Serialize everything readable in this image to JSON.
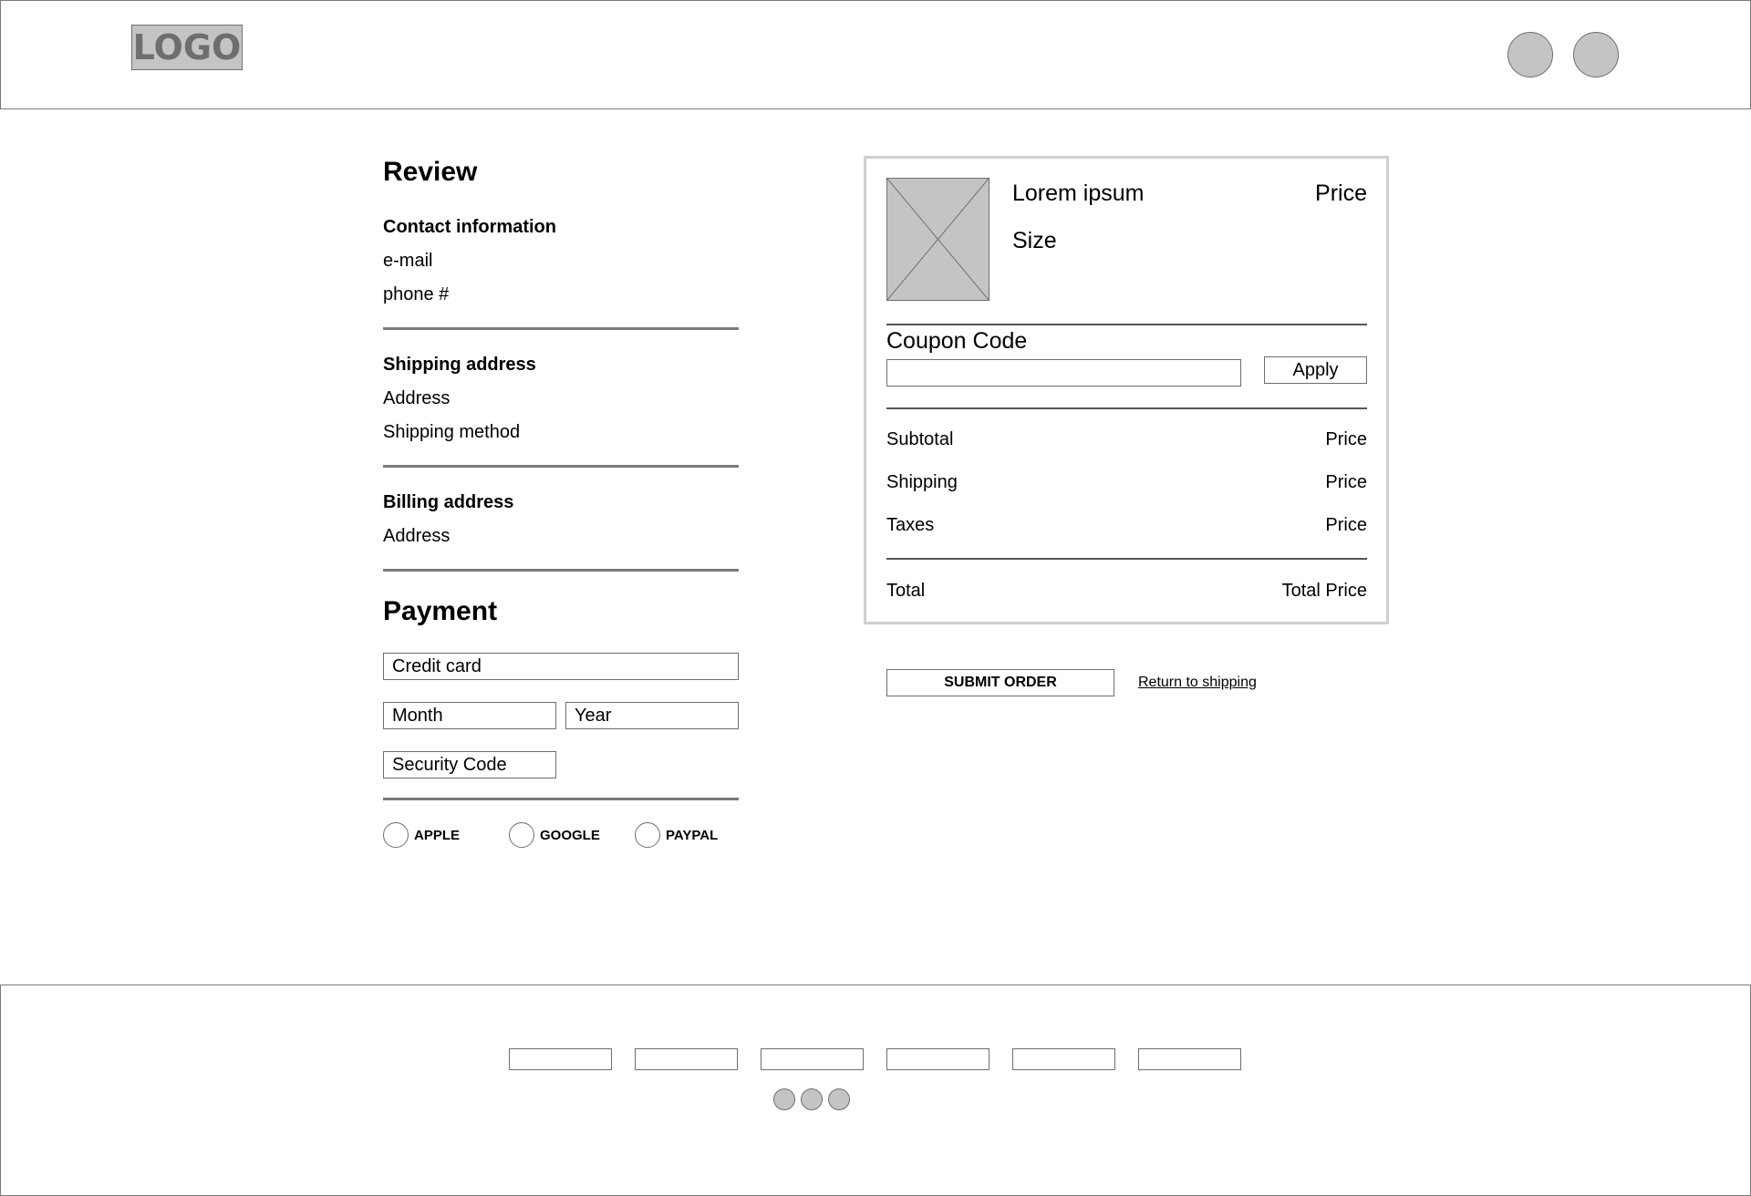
{
  "header": {
    "logo_text": "LOGO",
    "circle_buttons": [
      "user-icon",
      "cart-icon"
    ]
  },
  "review": {
    "title": "Review",
    "contact": {
      "heading": "Contact information",
      "email": "e-mail",
      "phone": "phone #"
    },
    "shipping": {
      "heading": "Shipping address",
      "address": "Address",
      "method": "Shipping method"
    },
    "billing": {
      "heading": "Billing address",
      "address": "Address"
    }
  },
  "payment": {
    "title": "Payment",
    "credit_card_placeholder": "Credit card",
    "month_placeholder": "Month",
    "year_placeholder": "Year",
    "security_placeholder": "Security Code",
    "options": [
      {
        "label": "APPLE"
      },
      {
        "label": "GOOGLE"
      },
      {
        "label": "PAYPAL"
      }
    ]
  },
  "order": {
    "product_name": "Lorem ipsum",
    "product_price": "Price",
    "product_size": "Size",
    "coupon_label": "Coupon Code",
    "coupon_value": "",
    "apply_label": "Apply",
    "lines": [
      {
        "label": "Subtotal",
        "value": "Price"
      },
      {
        "label": "Shipping",
        "value": "Price"
      },
      {
        "label": "Taxes",
        "value": "Price"
      }
    ],
    "total_label": "Total",
    "total_value": "Total Price"
  },
  "actions": {
    "submit_label": "SUBMIT ORDER",
    "return_label": "Return to shipping "
  },
  "footer": {
    "links": [
      "",
      "",
      "",
      "",
      "",
      ""
    ],
    "social_icons": [
      "social-icon-1",
      "social-icon-2",
      "social-icon-3"
    ]
  }
}
